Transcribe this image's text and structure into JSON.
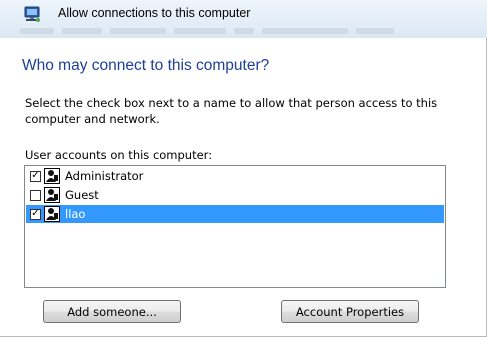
{
  "window": {
    "title": "Allow connections to this computer",
    "icon": "network-computer-icon"
  },
  "heading": "Who may connect to this computer?",
  "instructions": "Select the check box next to a name to allow that person access to this computer and network.",
  "list": {
    "label": "User accounts on this computer:",
    "users": [
      {
        "name": "Administrator",
        "checked": true,
        "selected": false,
        "icon": "user-icon"
      },
      {
        "name": "Guest",
        "checked": false,
        "selected": false,
        "icon": "user-icon"
      },
      {
        "name": "llao",
        "checked": true,
        "selected": true,
        "icon": "user-icon"
      }
    ],
    "selection_color": "#3399ff"
  },
  "buttons": {
    "add_someone": "Add someone...",
    "account_properties": "Account Properties"
  },
  "colors": {
    "heading": "#1f3f98"
  }
}
